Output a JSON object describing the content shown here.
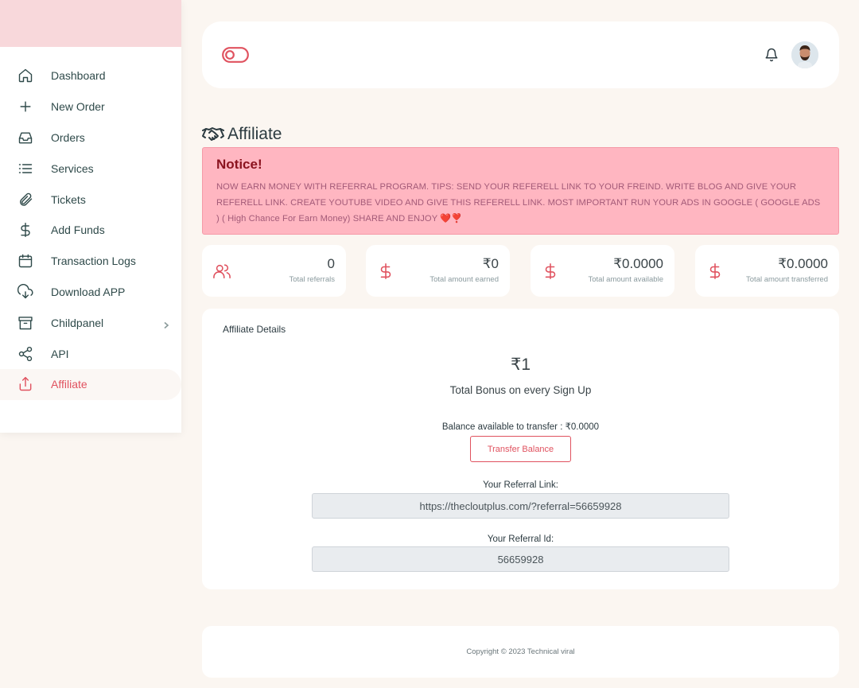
{
  "sidebar": {
    "items": [
      {
        "label": "Dashboard",
        "icon": "home-icon"
      },
      {
        "label": "New Order",
        "icon": "plus-icon"
      },
      {
        "label": "Orders",
        "icon": "inbox-icon"
      },
      {
        "label": "Services",
        "icon": "list-icon"
      },
      {
        "label": "Tickets",
        "icon": "paperclip-icon"
      },
      {
        "label": "Add Funds",
        "icon": "dollar-icon"
      },
      {
        "label": "Transaction Logs",
        "icon": "calendar-icon"
      },
      {
        "label": "Download APP",
        "icon": "download-cloud-icon"
      },
      {
        "label": "Childpanel",
        "icon": "archive-icon"
      },
      {
        "label": "API",
        "icon": "share-icon"
      },
      {
        "label": "Affiliate",
        "icon": "upload-icon"
      }
    ],
    "active_index": 10
  },
  "header": {
    "toggle_icon": "toggle-icon",
    "bell_icon": "bell-icon"
  },
  "page": {
    "title": "Affiliate",
    "title_icon": "handshake-icon"
  },
  "notice": {
    "title": "Notice!",
    "text": "NOW EARN MONEY WITH REFERRAL PROGRAM. TIPS: SEND YOUR REFERELL LINK TO YOUR FREIND. WRITE BLOG AND GIVE YOUR REFERELL LINK. CREATE YOUTUBE VIDEO AND GIVE THIS REFERELL LINK. MOST IMPORTANT RUN YOUR ADS IN GOOGLE ( GOOGLE ADS ) ( High Chance For Earn Money) SHARE AND ENJOY ❤️❣️"
  },
  "stats": [
    {
      "value": "0",
      "label": "Total referrals",
      "icon": "users-icon"
    },
    {
      "value": "₹0",
      "label": "Total amount earned",
      "icon": "dollar-icon"
    },
    {
      "value": "₹0.0000",
      "label": "Total amount available",
      "icon": "dollar-icon"
    },
    {
      "value": "₹0.0000",
      "label": "Total amount transferred",
      "icon": "dollar-icon"
    }
  ],
  "details": {
    "title": "Affiliate Details",
    "bonus_amount": "₹1",
    "bonus_label": "Total Bonus on every Sign Up",
    "balance_text": "Balance available to transfer : ₹0.0000",
    "transfer_button": "Transfer Balance",
    "referral_link_label": "Your Referral Link:",
    "referral_link": "https://thecloutplus.com/?referral=56659928",
    "referral_id_label": "Your Referral Id:",
    "referral_id": "56659928"
  },
  "footer": {
    "copyright": "Copyright © 2023 Technical viral"
  },
  "colors": {
    "accent": "#e0525f",
    "sidebar_top": "#f8d8db",
    "background": "#fbf6f1",
    "notice_bg": "#ffb6c1",
    "notice_title": "#8b1420"
  }
}
